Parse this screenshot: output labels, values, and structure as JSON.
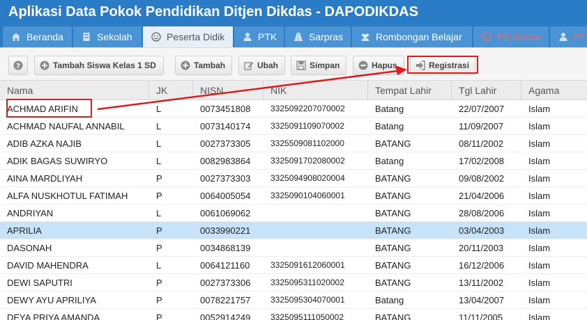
{
  "app": {
    "title": "Aplikasi Data Pokok Pendidikan Ditjen Dikdas - DAPODIKDAS"
  },
  "tabs": [
    {
      "label": "Beranda",
      "icon": "home-icon"
    },
    {
      "label": "Sekolah",
      "icon": "building-icon"
    },
    {
      "label": "Peserta Didik",
      "icon": "smile-icon",
      "active": true
    },
    {
      "label": "PTK",
      "icon": "person-icon"
    },
    {
      "label": "Sarpras",
      "icon": "road-icon"
    },
    {
      "label": "Rombongan Belajar",
      "icon": "group-icon"
    },
    {
      "label": "PD Keluar",
      "icon": "smile-icon",
      "disabled": true
    },
    {
      "label": "PT",
      "icon": "person-icon",
      "disabled": true
    }
  ],
  "toolbar": {
    "tambah_siswa": "Tambah Siswa Kelas 1 SD",
    "tambah": "Tambah",
    "ubah": "Ubah",
    "simpan": "Simpan",
    "hapus": "Hapus",
    "registrasi": "Registrasi"
  },
  "columns": [
    "Nama",
    "JK",
    "NISN",
    "NIK",
    "Tempat Lahir",
    "Tgl Lahir",
    "Agama"
  ],
  "rows": [
    [
      "ACHMAD ARIFIN",
      "L",
      "0073451808",
      "3325092207070002",
      "Batang",
      "22/07/2007",
      "Islam"
    ],
    [
      "ACHMAD NAUFAL ANNABIL",
      "L",
      "0073140174",
      "3325091109070002",
      "Batang",
      "11/09/2007",
      "Islam"
    ],
    [
      "ADIB AZKA NAJIB",
      "L",
      "0027373305",
      "3325509081102000",
      "BATANG",
      "08/11/2002",
      "Islam"
    ],
    [
      "ADIK BAGAS SUWIRYO",
      "L",
      "0082983864",
      "3325091702080002",
      "Batang",
      "17/02/2008",
      "Islam"
    ],
    [
      "AINA MARDLIYAH",
      "P",
      "0027373303",
      "3325094908020004",
      "BATANG",
      "09/08/2002",
      "Islam"
    ],
    [
      "ALFA NUSKHOTUL FATIMAH",
      "P",
      "0064005054",
      "3325090104060001",
      "BATANG",
      "21/04/2006",
      "Islam"
    ],
    [
      "ANDRIYAN",
      "L",
      "0061069062",
      "",
      "BATANG",
      "28/08/2006",
      "Islam"
    ],
    [
      "APRILIA",
      "P",
      "0033990221",
      "",
      "BATANG",
      "03/04/2003",
      "Islam"
    ],
    [
      "DASONAH",
      "P",
      "0034868139",
      "",
      "BATANG",
      "20/11/2003",
      "Islam"
    ],
    [
      "DAVID MAHENDRA",
      "L",
      "0064121160",
      "3325091612060001",
      "BATANG",
      "16/12/2006",
      "Islam"
    ],
    [
      "DEWI SAPUTRI",
      "P",
      "0027373306",
      "3325095311020002",
      "BATANG",
      "13/11/2002",
      "Islam"
    ],
    [
      "DEWY AYU APRILIYA",
      "P",
      "0078221757",
      "3325095304070001",
      "Batang",
      "13/04/2007",
      "Islam"
    ],
    [
      "DEYA PRIYA AMANDA",
      "P",
      "0052914249",
      "3325095111050002",
      "BATANG",
      "11/11/2005",
      "Islam"
    ]
  ],
  "selected_row": 7,
  "colors": {
    "header_blue": "#2a7cc7",
    "tab_blue": "#4a93d4",
    "selected_row": "#c8e3f8",
    "highlight_red": "#e01b1b"
  }
}
